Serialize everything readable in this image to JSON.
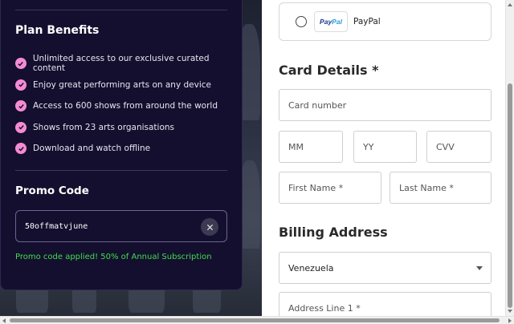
{
  "plan": {
    "title": "Plan Benefits",
    "benefits": [
      "Unlimited access to our exclusive curated content",
      "Enjoy great performing arts on any device",
      "Access to 600 shows from around the world",
      "Shows from 23 arts organisations",
      "Download and watch offline"
    ]
  },
  "promo": {
    "title": "Promo Code",
    "value": "50offmatvjune",
    "message": "Promo code applied! 50% of Annual Subscription"
  },
  "payment": {
    "paypal_logo_a": "Pay",
    "paypal_logo_b": "Pal",
    "paypal_label": "PayPal"
  },
  "card": {
    "title": "Card Details *",
    "card_number_placeholder": "Card number",
    "mm_placeholder": "MM",
    "yy_placeholder": "YY",
    "cvv_placeholder": "CVV",
    "first_name_placeholder": "First Name *",
    "last_name_placeholder": "Last Name *"
  },
  "billing": {
    "title": "Billing Address",
    "country": "Venezuela",
    "address_line1_placeholder": "Address Line 1 *"
  },
  "colors": {
    "panel_bg": "#140f2e",
    "check_pink": "#f48bd2",
    "success_green": "#3fdd4e"
  }
}
